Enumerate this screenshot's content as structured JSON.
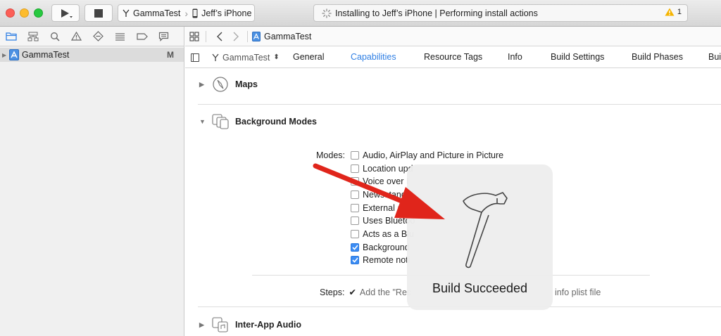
{
  "toolbar": {
    "run_icon": "play-icon",
    "stop_icon": "stop-icon",
    "scheme": {
      "name": "GammaTest",
      "device": "Jeff’s iPhone"
    },
    "activity": {
      "status": "Installing to Jeff’s iPhone | Performing install actions",
      "warning_count": "1"
    }
  },
  "navigator": {
    "icons": [
      "folder-icon",
      "hierarchy-icon",
      "search-icon",
      "warning-icon",
      "diamond-icon",
      "list-icon",
      "tag-icon",
      "chat-icon"
    ],
    "project": {
      "name": "GammaTest",
      "status": "M"
    }
  },
  "editor": {
    "jump_bar": {
      "crumb": "GammaTest"
    },
    "target": "GammaTest",
    "tabs": [
      "General",
      "Capabilities",
      "Resource Tags",
      "Info",
      "Build Settings",
      "Build Phases",
      "Bui"
    ],
    "active_tab": "Capabilities",
    "capabilities": {
      "maps": "Maps",
      "background_modes": "Background Modes",
      "modes_label": "Modes:",
      "modes": [
        {
          "label": "Audio, AirPlay and Picture in Picture",
          "checked": false
        },
        {
          "label": "Location upd",
          "checked": false
        },
        {
          "label": "Voice over I",
          "checked": false
        },
        {
          "label": "Newsstand d",
          "checked": false
        },
        {
          "label": "External ac",
          "checked": false
        },
        {
          "label": "Uses Bluetoo",
          "checked": false
        },
        {
          "label": "Acts as a Blu",
          "checked": false
        },
        {
          "label": "Background",
          "checked": true
        },
        {
          "label": "Remote noti",
          "checked": true
        }
      ],
      "steps_label": "Steps:",
      "steps_text": "Add the \"Rec",
      "steps_tail": "info plist file",
      "inter_app_audio": "Inter-App Audio"
    }
  },
  "hud": {
    "text": "Build Succeeded",
    "icon": "hammer-icon"
  },
  "colors": {
    "accent": "#2f7fe4",
    "arrow": "#e0251b",
    "checkbox_on": "#3b8cf3"
  }
}
